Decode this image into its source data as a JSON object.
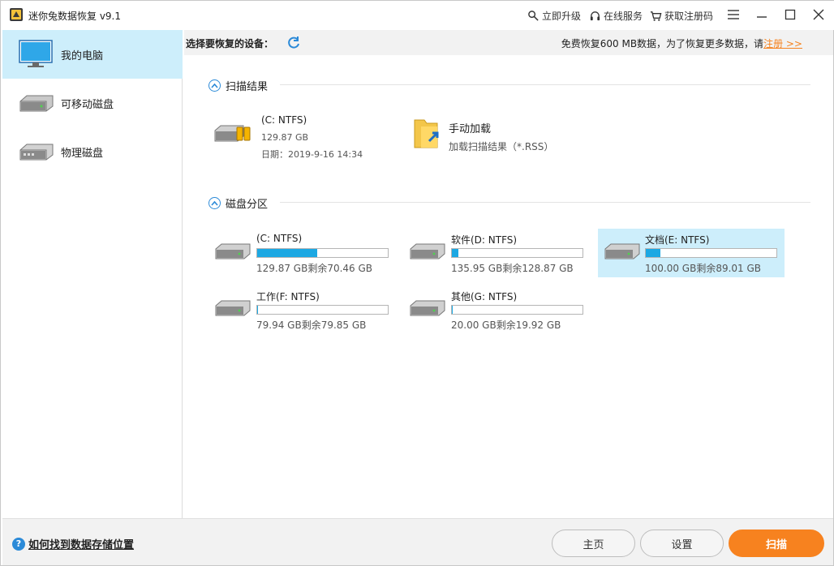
{
  "window": {
    "title": "迷你兔数据恢复 v9.1",
    "links": {
      "upgrade": "立即升级",
      "online_service": "在线服务",
      "get_code": "获取注册码"
    }
  },
  "sidebar": {
    "items": [
      {
        "label": "我的电脑",
        "icon": "monitor-icon",
        "active": true
      },
      {
        "label": "可移动磁盘",
        "icon": "removable-disk-icon",
        "active": false
      },
      {
        "label": "物理磁盘",
        "icon": "physical-disk-icon",
        "active": false
      }
    ]
  },
  "header": {
    "select_label": "选择要恢复的设备：",
    "notice": "免费恢复600 MB数据，为了恢复更多数据，请",
    "register": "注册 >>"
  },
  "scan_results": {
    "title": "扫描结果",
    "item": {
      "name": "(C: NTFS)",
      "size": "129.87 GB",
      "date": "日期：2019-9-16 14:34"
    },
    "manual_load": {
      "title": "手动加载",
      "subtitle": "加载扫描结果（*.RSS）"
    }
  },
  "partitions": {
    "title": "磁盘分区",
    "drives": [
      {
        "name": "(C: NTFS)",
        "size": "129.87 GB剩余70.46 GB",
        "used_pct": 45.7
      },
      {
        "name": "软件(D: NTFS)",
        "size": "135.95 GB剩余128.87 GB",
        "used_pct": 5.2
      },
      {
        "name": "文档(E: NTFS)",
        "size": "100.00 GB剩余89.01 GB",
        "used_pct": 11.0
      },
      {
        "name": "工作(F: NTFS)",
        "size": "79.94 GB剩余79.85 GB",
        "used_pct": 0.1
      },
      {
        "name": "其他(G: NTFS)",
        "size": "20.00 GB剩余19.92 GB",
        "used_pct": 0.4
      }
    ]
  },
  "footer": {
    "help": "如何找到数据存储位置",
    "home": "主页",
    "settings": "设置",
    "scan": "扫描"
  },
  "colors": {
    "accent": "#f7821f",
    "selection": "#cdeefb",
    "progress": "#1ca8e3",
    "link_blue": "#2b8ad8"
  }
}
